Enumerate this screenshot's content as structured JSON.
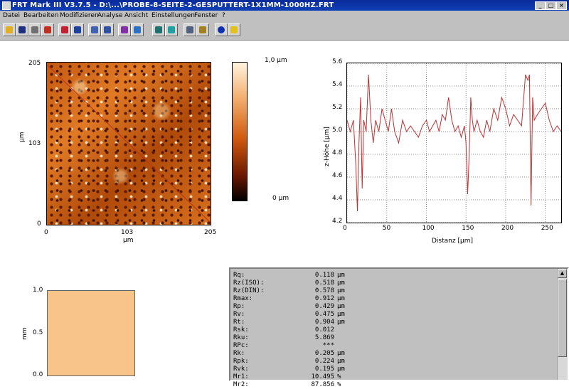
{
  "window": {
    "title": "FRT Mark III V3.7.5 - D:\\...\\PROBE-8-SEITE-2-GESPUTTERT-1X1MM-1000HZ.FRT"
  },
  "menu": [
    "Datei",
    "Bearbeiten",
    "Modifizieren",
    "Analyse",
    "Ansicht",
    "Einstellungen",
    "Fenster",
    "?"
  ],
  "toolbar": {
    "icons": [
      "open-icon",
      "save-icon",
      "print-icon",
      "export-icon",
      "leveling-icon",
      "filter-icon",
      "calc-icon",
      "histogram-icon",
      "statistics-icon",
      "profile-icon",
      "3d-view-icon",
      "zoom-icon",
      "settings-icon",
      "info-icon",
      "help-icon"
    ]
  },
  "afm_image": {
    "y_ticks": [
      "205",
      "103",
      "0"
    ],
    "x_ticks": [
      "0",
      "103",
      "205"
    ],
    "y_unit": "µm",
    "x_unit": "µm",
    "colorbar_max": "1,0 µm",
    "colorbar_min": "0 µm"
  },
  "profile": {
    "ylabel": "z-Höhe [µm]",
    "xlabel": "Distanz [µm]",
    "y_ticks": [
      "5.6",
      "5.4",
      "5.2",
      "5.0",
      "4.8",
      "4.6",
      "4.4",
      "4.2"
    ],
    "x_ticks": [
      "0",
      "50",
      "100",
      "150",
      "200",
      "250"
    ]
  },
  "chart_data": {
    "type": "line",
    "xlabel": "Distanz [µm]",
    "ylabel": "z-Höhe [µm]",
    "xlim": [
      0,
      270
    ],
    "ylim": [
      4.2,
      5.6
    ],
    "grid": true,
    "color": "#c03030",
    "x": [
      0,
      4,
      8,
      11,
      13,
      15,
      17,
      19,
      21,
      24,
      27,
      30,
      33,
      36,
      40,
      44,
      48,
      52,
      56,
      60,
      65,
      70,
      75,
      80,
      85,
      90,
      95,
      100,
      104,
      108,
      112,
      116,
      120,
      124,
      128,
      132,
      136,
      140,
      144,
      148,
      150,
      152,
      154,
      156,
      158,
      160,
      164,
      168,
      172,
      176,
      180,
      185,
      190,
      195,
      200,
      205,
      210,
      215,
      220,
      225,
      228,
      230,
      232,
      234,
      236,
      240,
      245,
      250,
      255,
      260,
      265,
      270
    ],
    "y": [
      5.1,
      5.0,
      5.1,
      4.7,
      4.3,
      4.9,
      5.3,
      4.5,
      5.1,
      5.0,
      5.5,
      5.1,
      4.9,
      5.1,
      5.0,
      5.2,
      5.1,
      5.0,
      5.2,
      5.0,
      4.9,
      5.1,
      5.0,
      5.05,
      5.0,
      4.95,
      5.05,
      5.1,
      5.0,
      5.05,
      5.1,
      5.0,
      5.15,
      5.1,
      5.3,
      5.1,
      5.0,
      5.05,
      4.95,
      5.05,
      4.9,
      4.45,
      4.8,
      5.3,
      5.1,
      5.0,
      5.1,
      5.0,
      4.95,
      5.1,
      5.0,
      5.2,
      5.1,
      5.3,
      5.2,
      5.05,
      5.15,
      5.1,
      5.05,
      5.5,
      5.45,
      5.5,
      4.35,
      5.3,
      5.1,
      5.15,
      5.2,
      5.25,
      5.1,
      5.0,
      5.05,
      5.0
    ]
  },
  "mini_map": {
    "y_ticks": [
      "1.0",
      "0.5",
      "0.0"
    ],
    "ylabel": "mm"
  },
  "statistics": [
    {
      "name": "Rq:",
      "value": "0.118",
      "unit": "µm"
    },
    {
      "name": "Rz(ISO):",
      "value": "0.518",
      "unit": "µm"
    },
    {
      "name": "Rz(DIN):",
      "value": "0.578",
      "unit": "µm"
    },
    {
      "name": "Rmax:",
      "value": "0.912",
      "unit": "µm"
    },
    {
      "name": "Rp:",
      "value": "0.429",
      "unit": "µm"
    },
    {
      "name": "Rv:",
      "value": "0.475",
      "unit": "µm"
    },
    {
      "name": "Rt:",
      "value": "0.904",
      "unit": "µm"
    },
    {
      "name": "Rsk:",
      "value": "0.012",
      "unit": ""
    },
    {
      "name": "Rku:",
      "value": "5.869",
      "unit": ""
    },
    {
      "name": "RPc:",
      "value": "***",
      "unit": ""
    },
    {
      "name": "Rk:",
      "value": "0.205",
      "unit": "µm"
    },
    {
      "name": "Rpk:",
      "value": "0.224",
      "unit": "µm"
    },
    {
      "name": "Rvk:",
      "value": "0.195",
      "unit": "µm"
    },
    {
      "name": "Mr1:",
      "value": "10.495",
      "unit": "%"
    },
    {
      "name": "Mr2:",
      "value": "87.856",
      "unit": "%"
    }
  ]
}
